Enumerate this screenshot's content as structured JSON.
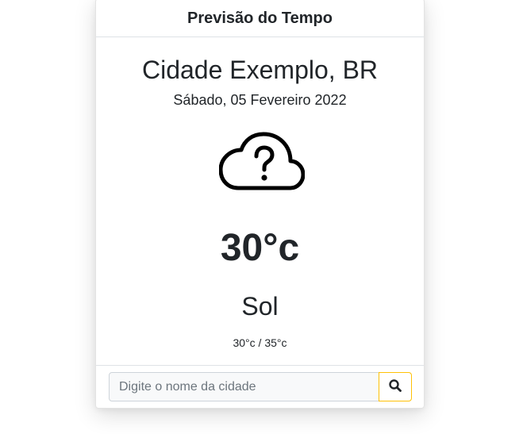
{
  "header": {
    "title": "Previsão do Tempo"
  },
  "location": {
    "city": "Cidade Exemplo, BR",
    "date": "Sábado, 05 Fevereiro 2022"
  },
  "weather": {
    "icon": "cloud-question-icon",
    "temperature": "30°c",
    "condition": "Sol",
    "min_max": "30°c / 35°c"
  },
  "search": {
    "placeholder": "Digite o nome da cidade",
    "value": "",
    "button_icon": "search-icon",
    "button_border_color": "#ffc107"
  }
}
